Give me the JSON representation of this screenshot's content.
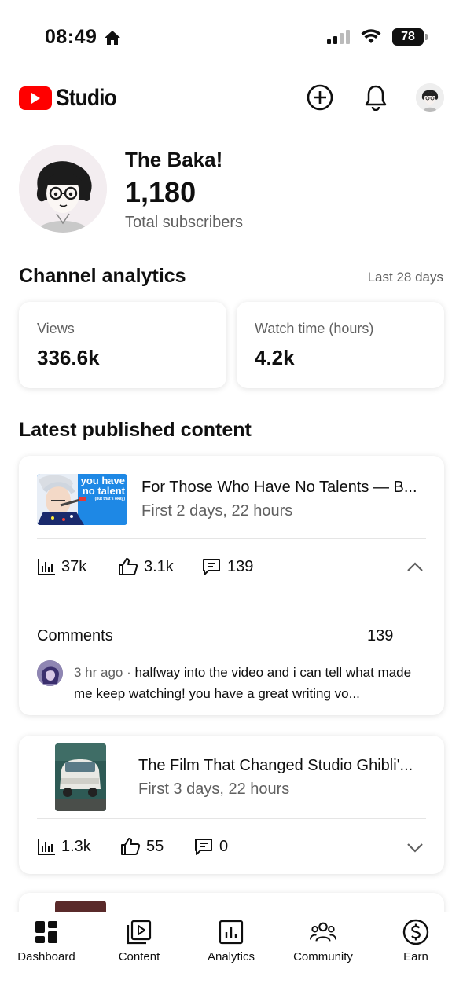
{
  "status_bar": {
    "time": "08:49",
    "battery": "78"
  },
  "header": {
    "app_name": "Studio"
  },
  "channel": {
    "name": "The Baka!",
    "subscribers": "1,180",
    "subscribers_label": "Total subscribers"
  },
  "analytics": {
    "title": "Channel analytics",
    "period": "Last 28 days",
    "stats": [
      {
        "label": "Views",
        "value": "336.6k"
      },
      {
        "label": "Watch time (hours)",
        "value": "4.2k"
      }
    ]
  },
  "latest": {
    "title": "Latest published content",
    "videos": [
      {
        "title": "For Those Who Have No Talents — B...",
        "subtitle": "First 2 days, 22 hours",
        "thumb_text": [
          "you have",
          "no talent",
          "(but that's okay)"
        ],
        "views": "37k",
        "likes": "3.1k",
        "comments": "139",
        "expanded": true,
        "comments_section": {
          "label": "Comments",
          "count": "139",
          "top_comment": {
            "ago": "3 hr ago",
            "separator": "·",
            "text": "halfway into the video and i can tell what made me keep watching! you have a great writing vo..."
          }
        }
      },
      {
        "title": "The Film That Changed Studio Ghibli'...",
        "subtitle": "First 3 days, 22 hours",
        "views": "1.3k",
        "likes": "55",
        "comments": "0",
        "expanded": false
      }
    ]
  },
  "bottom_nav": [
    {
      "label": "Dashboard",
      "icon": "dashboard-icon"
    },
    {
      "label": "Content",
      "icon": "content-icon"
    },
    {
      "label": "Analytics",
      "icon": "analytics-icon"
    },
    {
      "label": "Community",
      "icon": "community-icon"
    },
    {
      "label": "Earn",
      "icon": "earn-icon"
    }
  ],
  "colors": {
    "brand_red": "#ff0000",
    "text": "#0f0f0f",
    "secondary_text": "#606060",
    "thumb_blue": "#1e88e5"
  }
}
